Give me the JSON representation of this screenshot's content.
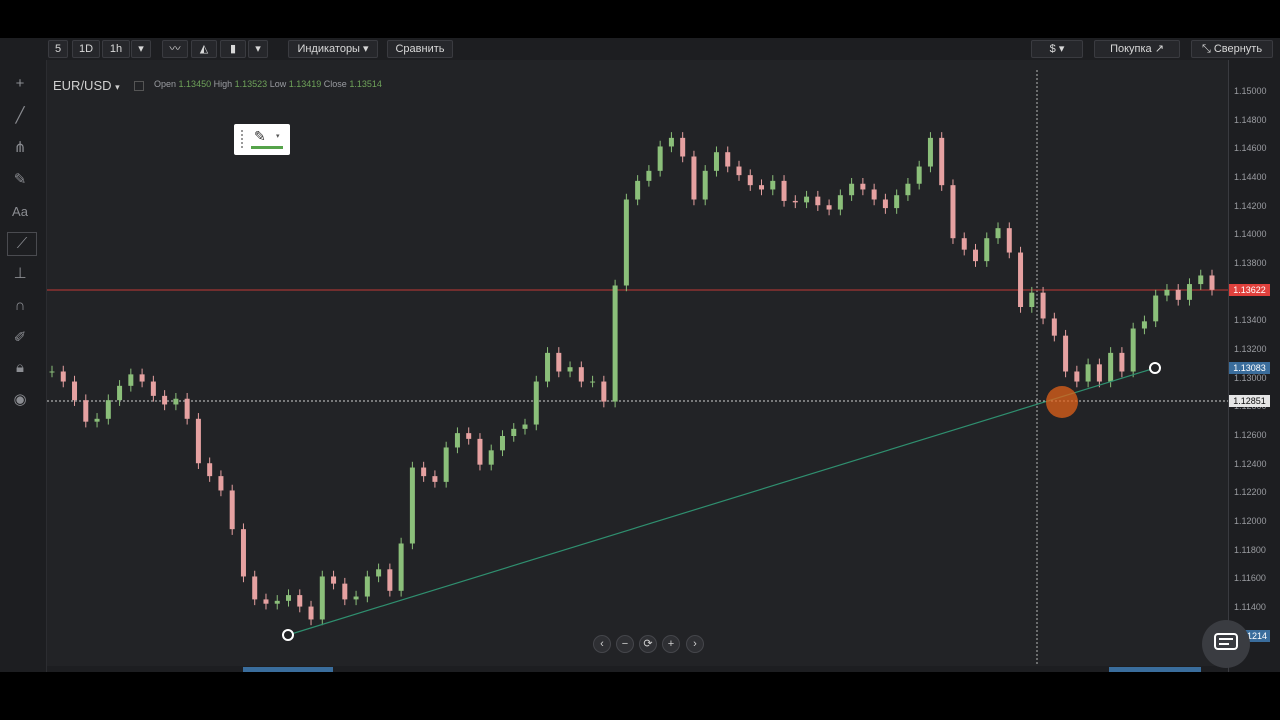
{
  "toolbar": {
    "interval_1": "5",
    "interval_2": "1D",
    "interval_3": "1h",
    "indicators_label": "Индикаторы",
    "compare_label": "Сравнить",
    "currency_label": "$",
    "buy_label": "Покупка",
    "collapse_label": "Свернуть"
  },
  "instrument": {
    "symbol": "EUR/USD",
    "open_label": "Open",
    "open_value": "1.13450",
    "high_label": "High",
    "high_value": "1.13523",
    "low_label": "Low",
    "low_value": "1.13419",
    "close_label": "Close",
    "close_value": "1.13514"
  },
  "price_axis": {
    "ticks": [
      "1.15000",
      "1.14800",
      "1.14600",
      "1.14400",
      "1.14200",
      "1.14000",
      "1.13800",
      "1.13600",
      "1.13400",
      "1.13200",
      "1.13000",
      "1.12800",
      "1.12600",
      "1.12400",
      "1.12200",
      "1.12000",
      "1.11800",
      "1.11600",
      "1.11400"
    ],
    "current_price": "1.13622",
    "trendline_price": "1.13083",
    "crosshair_price": "1.12851",
    "partial_bottom_tag": "1214"
  },
  "nav_controls": {
    "prev": "‹",
    "zoom_out": "−",
    "reset": "⟳",
    "zoom_in": "+",
    "next": "›"
  },
  "colors": {
    "background": "#222326",
    "up_candle": "#8bbf7a",
    "down_candle": "#e6a1a1",
    "current_price_line": "#e0413d",
    "trendline": "#2f8f6f",
    "trendline_tag": "#3a6d9c",
    "highlight_marker": "#e0621a"
  },
  "chart_data": {
    "type": "candlestick",
    "symbol": "EUR/USD",
    "ylim": [
      1.1125,
      1.1515
    ],
    "x": [
      0,
      4,
      8,
      12,
      16,
      20,
      24,
      28,
      32,
      36,
      40,
      44,
      48,
      52,
      56,
      60,
      64,
      68,
      72,
      76,
      80,
      84,
      88,
      92,
      96,
      100,
      104,
      108,
      112,
      116,
      120,
      124,
      128,
      132,
      136,
      140,
      144,
      148,
      152,
      156,
      160,
      164,
      168,
      172,
      176,
      180,
      184,
      188,
      192,
      196,
      200,
      204,
      208,
      212,
      216,
      220,
      224,
      228,
      232,
      236,
      240,
      244,
      248,
      252,
      256,
      260,
      264,
      268,
      272,
      276,
      280,
      284
    ],
    "close": [
      1.1305,
      1.1298,
      1.1285,
      1.127,
      1.1272,
      1.1285,
      1.1295,
      1.1303,
      1.1298,
      1.1288,
      1.1282,
      1.1286,
      1.1272,
      1.1241,
      1.1232,
      1.1222,
      1.1195,
      1.1162,
      1.1146,
      1.1143,
      1.1145,
      1.1149,
      1.1141,
      1.1132,
      1.1162,
      1.1157,
      1.1146,
      1.1148,
      1.1162,
      1.1167,
      1.1152,
      1.1185,
      1.1238,
      1.1232,
      1.1228,
      1.1252,
      1.1262,
      1.1258,
      1.124,
      1.125,
      1.126,
      1.1265,
      1.1268,
      1.1298,
      1.1318,
      1.1305,
      1.1308,
      1.1298,
      1.1298,
      1.1284,
      1.1365,
      1.1425,
      1.1438,
      1.1445,
      1.1462,
      1.1468,
      1.1455,
      1.1425,
      1.1445,
      1.1458,
      1.1448,
      1.1442,
      1.1435,
      1.1432,
      1.1438,
      1.1424,
      1.1423,
      1.1427,
      1.1421,
      1.1418,
      1.1428,
      1.1436
    ],
    "close_continued": [
      1.1432,
      1.1425,
      1.1419,
      1.1428,
      1.1436,
      1.1448,
      1.1468,
      1.1435,
      1.1398,
      1.139,
      1.1382,
      1.1398,
      1.1405,
      1.1388,
      1.135,
      1.136,
      1.1342,
      1.133,
      1.1305,
      1.1298,
      1.131,
      1.1298,
      1.1318,
      1.1305,
      1.1335,
      1.134,
      1.1358,
      1.1362,
      1.1355,
      1.1366,
      1.1372,
      1.1362
    ],
    "current_price": 1.13622,
    "annotations": [
      {
        "type": "trendline",
        "from_price": 1.1132,
        "to_price": 1.13083
      },
      {
        "type": "horizontal_line",
        "price": 1.13622,
        "label": "1.13622"
      },
      {
        "type": "crosshair",
        "price": 1.12851
      }
    ],
    "grid": false
  }
}
